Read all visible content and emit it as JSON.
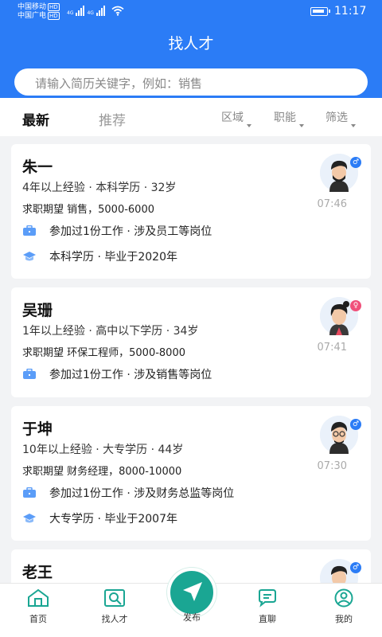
{
  "status_bar": {
    "carrier1": "中国移动",
    "carrier2": "中国广电",
    "hd": "HD",
    "net1": "4G",
    "net2": "4G",
    "time": "11:17"
  },
  "header": {
    "title": "找人才",
    "search_placeholder": "请输入简历关键字，例如：销售"
  },
  "tabs": {
    "latest": "最新",
    "recommend": "推荐",
    "area": "区域",
    "function": "职能",
    "filter": "筛选"
  },
  "candidates": [
    {
      "name": "朱一",
      "meta": "4年以上经验 · 本科学历 · 32岁",
      "expect": "求职期望 销售，5000-6000",
      "work": "参加过1份工作 · 涉及员工等岗位",
      "edu": "本科学历 · 毕业于2020年",
      "time": "07:46",
      "gender": "male"
    },
    {
      "name": "吴珊",
      "meta": "1年以上经验 · 高中以下学历 · 34岁",
      "expect": "求职期望 环保工程师，5000-8000",
      "work": "参加过1份工作 · 涉及销售等岗位",
      "time": "07:41",
      "gender": "female"
    },
    {
      "name": "于坤",
      "meta": "10年以上经验 · 大专学历 · 44岁",
      "expect": "求职期望 财务经理，8000-10000",
      "work": "参加过1份工作 · 涉及财务总监等岗位",
      "edu": "大专学历 · 毕业于2007年",
      "time": "07:30",
      "gender": "male"
    },
    {
      "name": "老王",
      "gender": "male"
    }
  ],
  "nav": {
    "home": "首页",
    "find_talent": "找人才",
    "publish": "发布",
    "chat": "直聊",
    "mine": "我的"
  },
  "colors": {
    "primary_blue": "#2b7cf6",
    "accent_green": "#1aa693"
  }
}
